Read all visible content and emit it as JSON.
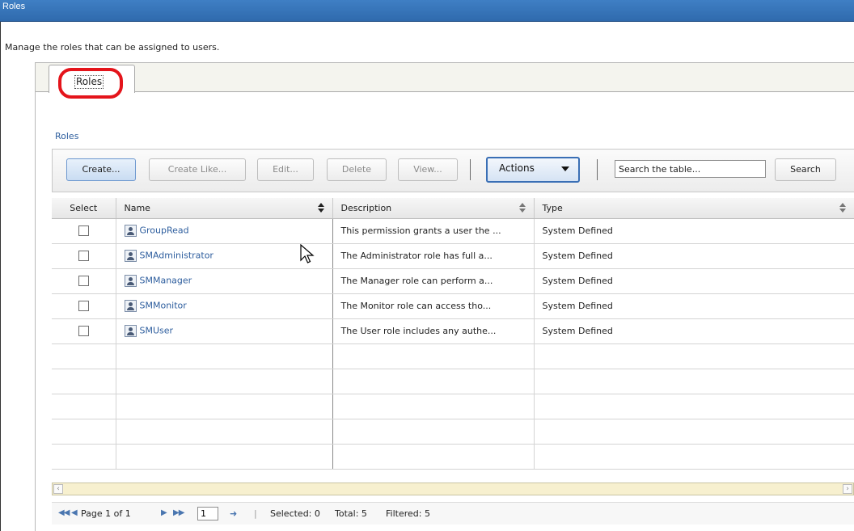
{
  "window": {
    "title": "Roles"
  },
  "intro": "Manage the roles that can be assigned to users.",
  "tabs": [
    {
      "label": "Roles",
      "active": true
    }
  ],
  "section": {
    "label": "Roles"
  },
  "toolbar": {
    "create": "Create...",
    "create_like": "Create Like...",
    "edit": "Edit...",
    "delete": "Delete",
    "view": "View...",
    "actions": "Actions",
    "search_placeholder": "Search the table...",
    "search": "Search"
  },
  "table": {
    "headers": {
      "select": "Select",
      "name": "Name",
      "description": "Description",
      "type": "Type"
    },
    "rows": [
      {
        "name": "GroupRead",
        "description": "This permission grants a user the ...",
        "type": "System Defined"
      },
      {
        "name": "SMAdministrator",
        "description": "The Administrator role has full a...",
        "type": "System Defined"
      },
      {
        "name": "SMManager",
        "description": "The Manager role can perform a...",
        "type": "System Defined"
      },
      {
        "name": "SMMonitor",
        "description": "The Monitor role can access tho...",
        "type": "System Defined"
      },
      {
        "name": "SMUser",
        "description": "The User role includes any authe...",
        "type": "System Defined"
      }
    ]
  },
  "pager": {
    "page_text": "Page 1 of 1",
    "page_value": "1",
    "selected": "Selected: 0",
    "total": "Total: 5",
    "filtered": "Filtered: 5"
  },
  "colors": {
    "titlebar": "#3a78bd",
    "highlight": "#e4141b",
    "link": "#2e5e9e"
  },
  "icons": [
    "role-icon",
    "checkbox-icon",
    "sort-icon",
    "first-page-icon",
    "prev-page-icon",
    "next-page-icon",
    "last-page-icon",
    "go-icon",
    "chevron-down-icon",
    "mouse-pointer-icon"
  ]
}
